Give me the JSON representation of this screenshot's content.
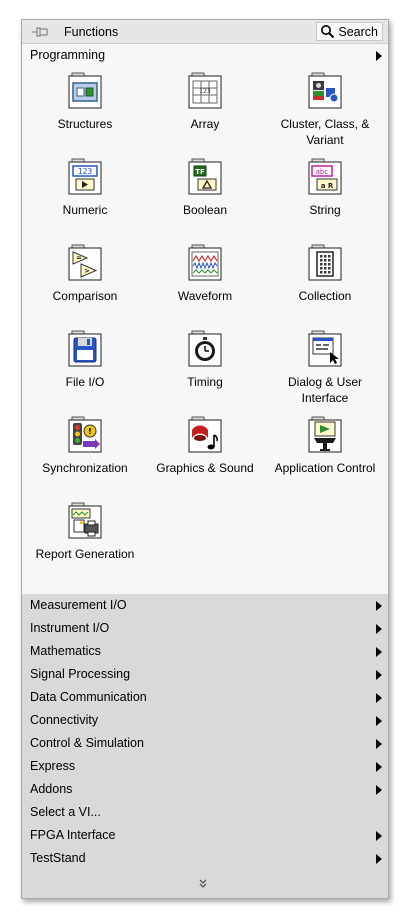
{
  "titlebar": {
    "title": "Functions",
    "search_label": "Search"
  },
  "programming": {
    "label": "Programming"
  },
  "items": [
    {
      "label": "Structures"
    },
    {
      "label": "Array"
    },
    {
      "label": "Cluster, Class, & Variant"
    },
    {
      "label": "Numeric"
    },
    {
      "label": "Boolean"
    },
    {
      "label": "String"
    },
    {
      "label": "Comparison"
    },
    {
      "label": "Waveform"
    },
    {
      "label": "Collection"
    },
    {
      "label": "File I/O"
    },
    {
      "label": "Timing"
    },
    {
      "label": "Dialog & User Interface"
    },
    {
      "label": "Synchronization"
    },
    {
      "label": "Graphics & Sound"
    },
    {
      "label": "Application Control"
    },
    {
      "label": "Report Generation"
    }
  ],
  "icon_glyphs": {
    "array_digits": "123",
    "numeric_digits": "123",
    "boolean_tf": "TF",
    "string_abc": "abc"
  },
  "categories": [
    {
      "label": "Measurement I/O"
    },
    {
      "label": "Instrument I/O"
    },
    {
      "label": "Mathematics"
    },
    {
      "label": "Signal Processing"
    },
    {
      "label": "Data Communication"
    },
    {
      "label": "Connectivity"
    },
    {
      "label": "Control & Simulation"
    },
    {
      "label": "Express"
    },
    {
      "label": "Addons"
    },
    {
      "label": "Select a VI..."
    },
    {
      "label": "FPGA Interface"
    },
    {
      "label": "TestStand"
    }
  ]
}
